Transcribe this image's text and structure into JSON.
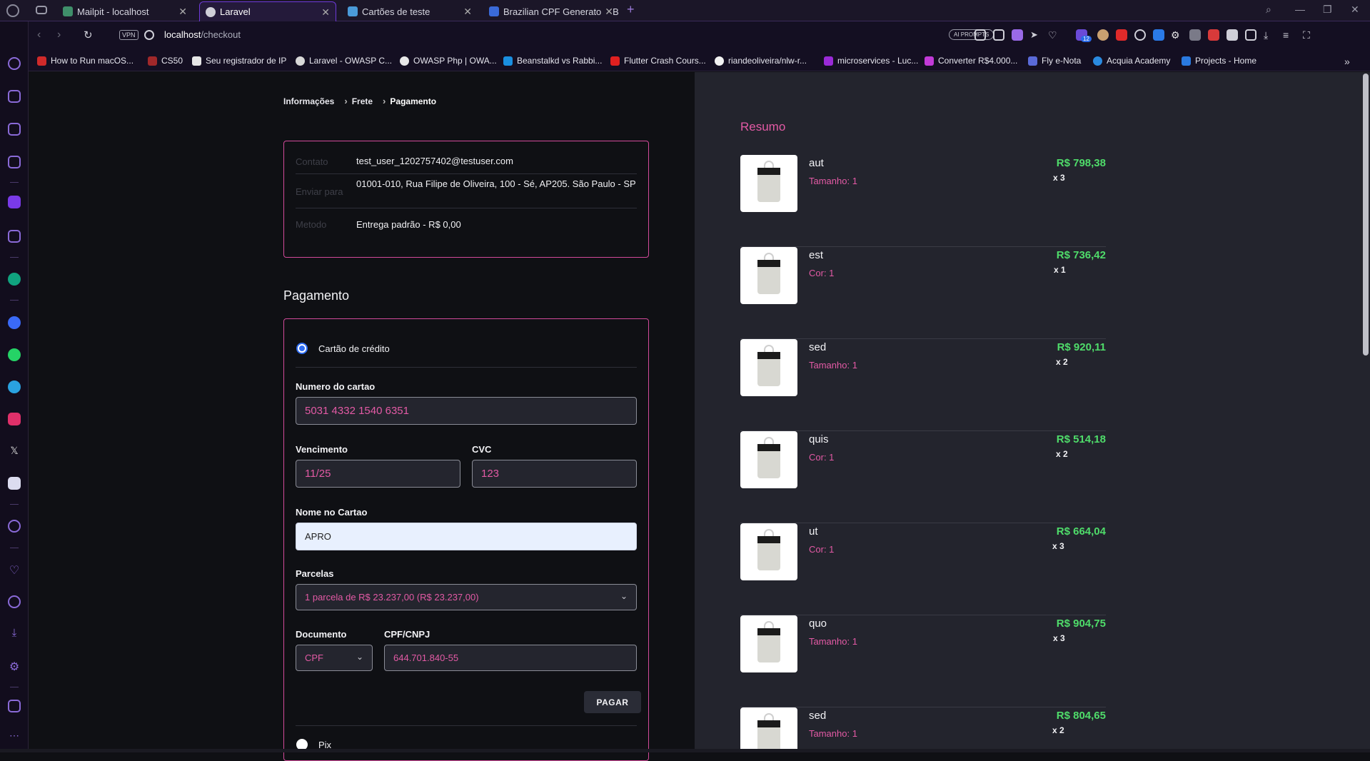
{
  "browser": {
    "tabs": [
      {
        "label": "Mailpit - localhost",
        "color": "#3f8f6a"
      },
      {
        "label": "Laravel",
        "color": "#cfcfd8"
      },
      {
        "label": "Cartões de teste",
        "color": "#4a9ad8"
      },
      {
        "label": "Brazilian CPF Generator - B",
        "color": "#3a6ad8"
      }
    ],
    "vpn_label": "VPN",
    "url_host": "localhost",
    "url_path": "/checkout",
    "ai_prompts_label": "AI PROMPTS",
    "extension_badge": "12",
    "bookmarks": [
      {
        "label": "How to Run macOS...",
        "color": "#d02a2a"
      },
      {
        "label": "CS50",
        "color": "#a0282a"
      },
      {
        "label": "Seu registrador de IP",
        "color": "#e6e6e6"
      },
      {
        "label": "Laravel - OWASP C...",
        "color": "#d8d8d8"
      },
      {
        "label": "OWASP Php | OWA...",
        "color": "#e8e8e8"
      },
      {
        "label": "Beanstalkd vs Rabbi...",
        "color": "#1a8fe0"
      },
      {
        "label": "Flutter Crash Cours...",
        "color": "#e02020"
      },
      {
        "label": "riandeoliveira/nlw-r...",
        "color": "#f2f2f2"
      },
      {
        "label": "microservices - Luc...",
        "color": "#9a2ad8"
      },
      {
        "label": "Converter R$4.000...",
        "color": "#c23ad8"
      },
      {
        "label": "Fly e-Nota",
        "color": "#5a6ad8"
      },
      {
        "label": "Acquia Academy",
        "color": "#2a8ae0"
      },
      {
        "label": "Projects - Home",
        "color": "#2a7ae0"
      }
    ]
  },
  "breadcrumb": {
    "step1": "Informações",
    "step2": "Frete",
    "step3": "Pagamento"
  },
  "summary": {
    "contact_label": "Contato",
    "contact_value": "test_user_1202757402@testuser.com",
    "ship_label": "Enviar para",
    "ship_value": "01001-010, Rua Filipe de Oliveira, 100 - Sé, AP205. São Paulo - SP",
    "method_label": "Metodo",
    "method_value": "Entrega padrão - R$ 0,00"
  },
  "payment": {
    "title": "Pagamento",
    "credit_card_label": "Cartão de crédito",
    "card_number_label": "Numero do cartao",
    "card_number_value": "5031 4332 1540 6351",
    "expiry_label": "Vencimento",
    "expiry_value": "11/25",
    "cvc_label": "CVC",
    "cvc_value": "123",
    "name_label": "Nome no Cartao",
    "name_value": "APRO",
    "installments_label": "Parcelas",
    "installments_value": "1 parcela de R$ 23.237,00 (R$ 23.237,00)",
    "doc_label": "Documento",
    "doc_value": "CPF",
    "cpf_label": "CPF/CNPJ",
    "cpf_value": "644.701.840-55",
    "pay_button": "PAGAR",
    "pix_label": "Pix"
  },
  "resumo": {
    "title": "Resumo",
    "items": [
      {
        "name": "aut",
        "variant": "Tamanho: 1",
        "price": "R$ 798,38",
        "qty": "x 3"
      },
      {
        "name": "est",
        "variant": "Cor: 1",
        "price": "R$ 736,42",
        "qty": "x 1"
      },
      {
        "name": "sed",
        "variant": "Tamanho: 1",
        "price": "R$ 920,11",
        "qty": "x 2"
      },
      {
        "name": "quis",
        "variant": "Cor: 1",
        "price": "R$ 514,18",
        "qty": "x 2"
      },
      {
        "name": "ut",
        "variant": "Cor: 1",
        "price": "R$ 664,04",
        "qty": "x 3"
      },
      {
        "name": "quo",
        "variant": "Tamanho: 1",
        "price": "R$ 904,75",
        "qty": "x 3"
      },
      {
        "name": "sed",
        "variant": "Tamanho: 1",
        "price": "R$ 804,65",
        "qty": "x 2"
      }
    ]
  }
}
